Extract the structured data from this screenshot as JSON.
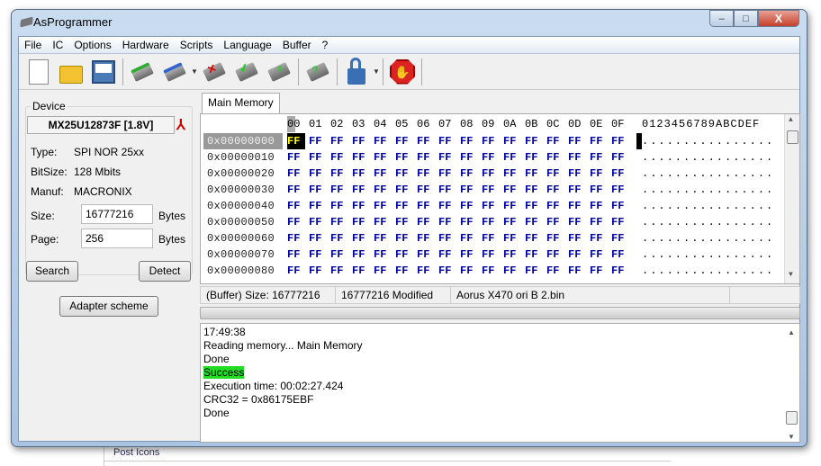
{
  "window": {
    "title": "AsProgrammer",
    "minimize": "–",
    "maximize": "□",
    "close": "X"
  },
  "menu": [
    "File",
    "IC",
    "Options",
    "Hardware",
    "Scripts",
    "Language",
    "Buffer",
    "?"
  ],
  "toolbar": [
    "new-file",
    "open-file",
    "save-file",
    "read-chip",
    "write-chip",
    "erase-chip",
    "verify-chip",
    "compare-chip",
    "blank-check",
    "unlock",
    "stop"
  ],
  "device": {
    "group_label": "Device",
    "name": "MX25U12873F [1.8V]",
    "type_label": "Type:",
    "type": "SPI NOR 25xx",
    "bitsize_label": "BitSize:",
    "bitsize": "128 Mbits",
    "manuf_label": "Manuf:",
    "manuf": "MACRONIX",
    "size_label": "Size:",
    "size": "16777216",
    "size_unit": "Bytes",
    "page_label": "Page:",
    "page": "256",
    "page_unit": "Bytes",
    "search": "Search",
    "detect": "Detect",
    "adapter": "Adapter scheme"
  },
  "hex": {
    "tab": "Main Memory",
    "columns": [
      "00",
      "01",
      "02",
      "03",
      "04",
      "05",
      "06",
      "07",
      "08",
      "09",
      "0A",
      "0B",
      "0C",
      "0D",
      "0E",
      "0F"
    ],
    "ascii_header": "0123456789ABCDEF",
    "rows": [
      {
        "addr": "0x00000000",
        "bytes": "FF FF FF FF FF FF FF FF FF FF FF FF FF FF FF FF",
        "ascii": "................"
      },
      {
        "addr": "0x00000010",
        "bytes": "FF FF FF FF FF FF FF FF FF FF FF FF FF FF FF FF",
        "ascii": "................"
      },
      {
        "addr": "0x00000020",
        "bytes": "FF FF FF FF FF FF FF FF FF FF FF FF FF FF FF FF",
        "ascii": "................"
      },
      {
        "addr": "0x00000030",
        "bytes": "FF FF FF FF FF FF FF FF FF FF FF FF FF FF FF FF",
        "ascii": "................"
      },
      {
        "addr": "0x00000040",
        "bytes": "FF FF FF FF FF FF FF FF FF FF FF FF FF FF FF FF",
        "ascii": "................"
      },
      {
        "addr": "0x00000050",
        "bytes": "FF FF FF FF FF FF FF FF FF FF FF FF FF FF FF FF",
        "ascii": "................"
      },
      {
        "addr": "0x00000060",
        "bytes": "FF FF FF FF FF FF FF FF FF FF FF FF FF FF FF FF",
        "ascii": "................"
      },
      {
        "addr": "0x00000070",
        "bytes": "FF FF FF FF FF FF FF FF FF FF FF FF FF FF FF FF",
        "ascii": "................"
      },
      {
        "addr": "0x00000080",
        "bytes": "FF FF FF FF FF FF FF FF FF FF FF FF FF FF FF FF",
        "ascii": "................"
      }
    ]
  },
  "status": {
    "size": "(Buffer) Size: 16777216",
    "modified": "16777216 Modified",
    "file": "Aorus X470 ori B 2.bin"
  },
  "log": [
    "17:49:38",
    "Reading memory... Main Memory",
    "Done",
    "Success",
    "Execution time: 00:02:27.424",
    "CRC32 = 0x86175EBF",
    "Done"
  ],
  "background": {
    "text": "Post Icons"
  }
}
